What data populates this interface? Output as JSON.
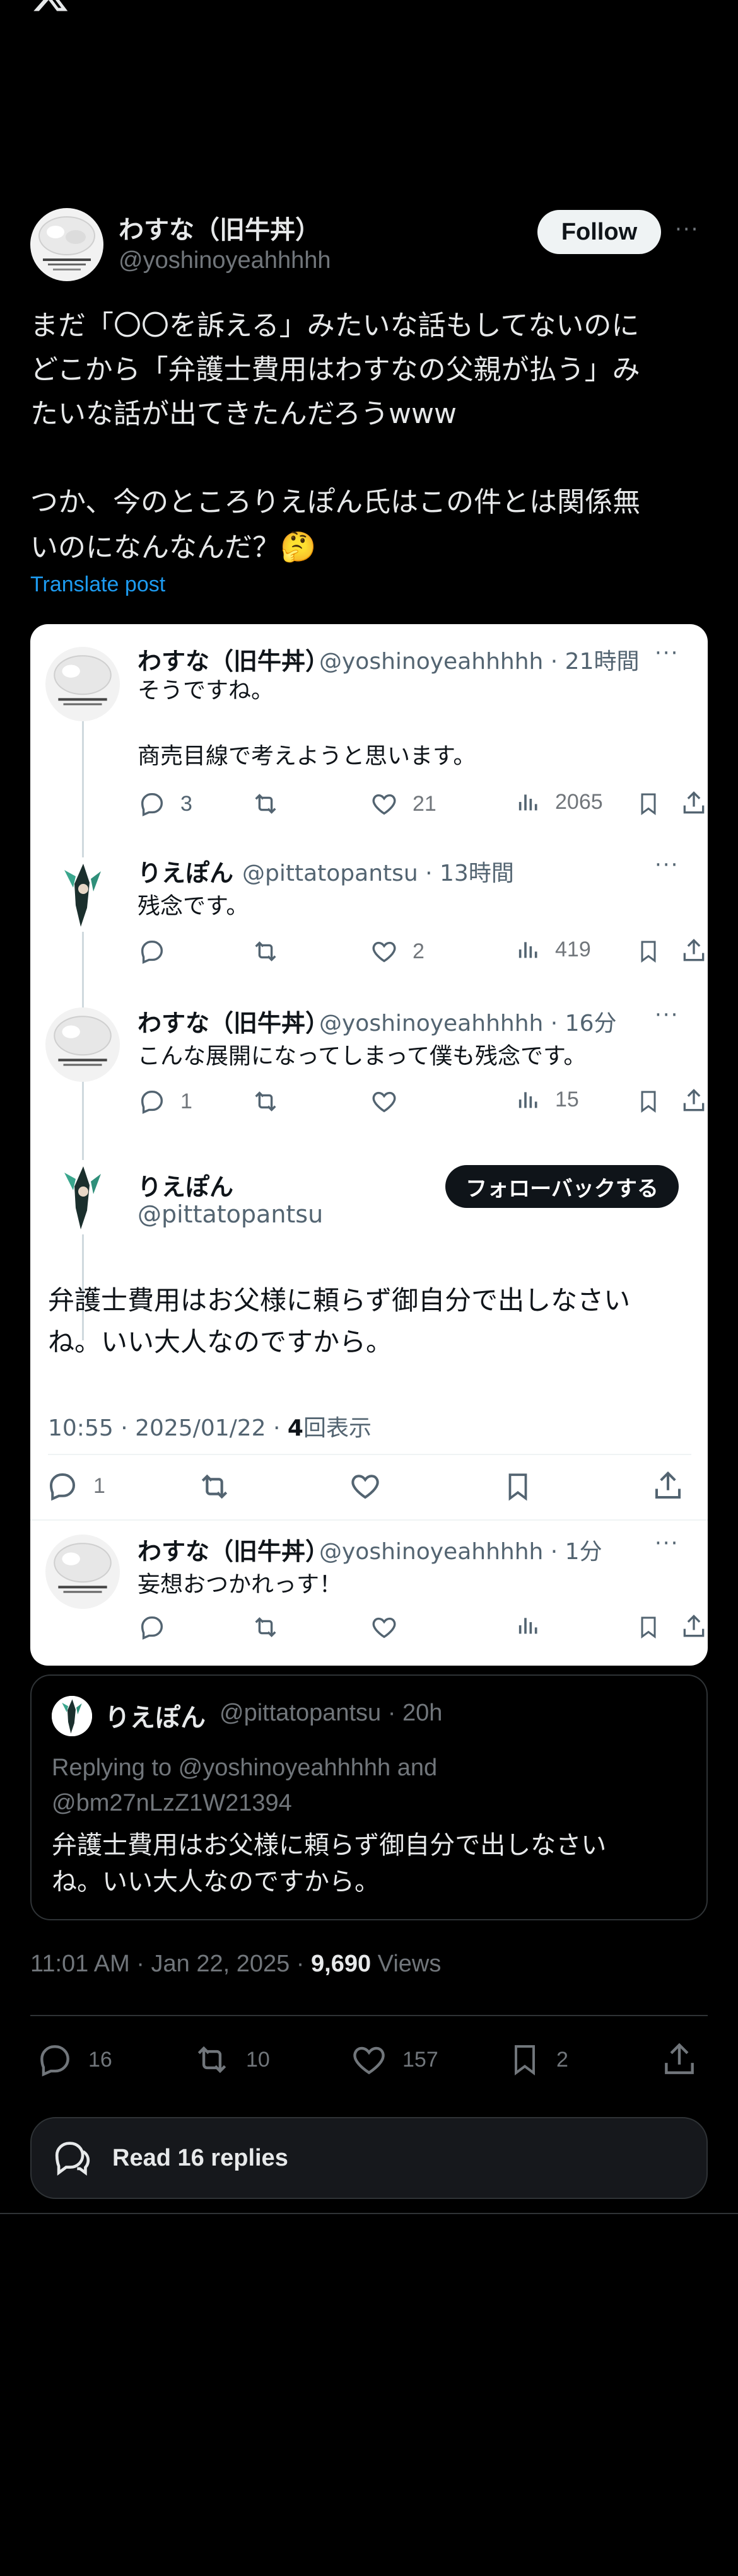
{
  "header": {
    "logo_icon": "x-logo-icon"
  },
  "post": {
    "author_name": "わすな（旧牛丼）",
    "author_handle": "@yoshinoyeahhhhh",
    "follow_label": "Follow",
    "more": "···",
    "text_lines": [
      "まだ「〇〇を訴える」みたいな話もしてないのに",
      "どこから「弁護士費用はわすなの父親が払う」み",
      "たいな話が出てきたんだろうwww",
      "",
      "つか、今のところりえぽん氏はこの件とは関係無",
      "いのになんなんだ？"
    ],
    "emoji": "🤔",
    "translate_label": "Translate post",
    "timestamp": "11:01 AM · Jan 22, 2025 · ",
    "views_count": "9,690",
    "views_label": " Views",
    "stats": {
      "replies": "16",
      "reposts": "10",
      "likes": "157",
      "bookmarks": "2"
    },
    "read_replies_label": "Read 16 replies"
  },
  "image": {
    "tweets": [
      {
        "name": "わすな（旧牛丼）",
        "handle": "@yoshinoyeahhhhh · 21時間",
        "lines": [
          "そうですね。",
          "",
          "商売目線で考えようと思います。"
        ],
        "replies": "3",
        "likes": "21",
        "views": "2065"
      },
      {
        "name": "りえぽん",
        "handle": "@pittatopantsu · 13時間",
        "lines": [
          "残念です。"
        ],
        "replies": "",
        "likes": "2",
        "views": "419"
      },
      {
        "name": "わすな（旧牛丼）",
        "handle": "@yoshinoyeahhhhh · 16分",
        "lines": [
          "こんな展開になってしまって僕も残念です。"
        ],
        "replies": "1",
        "likes": "",
        "views": "15"
      }
    ],
    "focus": {
      "name": "りえぽん",
      "handle": "@pittatopantsu",
      "followback_label": "フォローバックする",
      "lines": [
        "弁護士費用はお父様に頼らず御自分で出しなさい",
        "ね。いい大人なのですから。"
      ],
      "meta_time": "10:55 · 2025/01/22 · ",
      "meta_views": "4",
      "meta_views_label": "回表示",
      "replies": "1"
    },
    "last": {
      "name": "わすな（旧牛丼）",
      "handle": "@yoshinoyeahhhhh · 1分",
      "lines": [
        "妄想おつかれっす！"
      ]
    },
    "more": "···"
  },
  "quote": {
    "name": "りえぽん",
    "handle_time": "@pittatopantsu · 20h",
    "reply_line1": "Replying to @yoshinoyeahhhhh and",
    "reply_line2": "@bm27nLzZ1W21394",
    "lines": [
      "弁護士費用はお父様に頼らず御自分で出しなさい",
      "ね。いい大人なのですから。"
    ]
  },
  "colors": {
    "accent": "#1d9bf0",
    "bg": "#000000",
    "card_bg": "#ffffff",
    "muted": "#71767b"
  }
}
